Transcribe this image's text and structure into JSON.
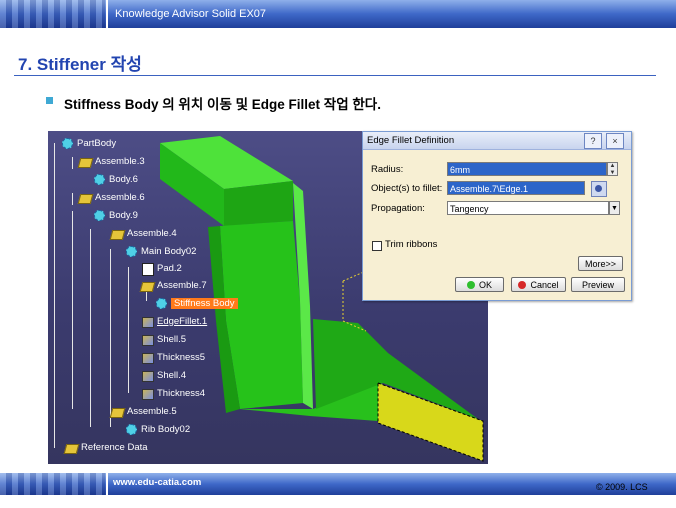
{
  "header": {
    "title": "Knowledge Advisor Solid EX07"
  },
  "slide": {
    "title": "7. Stiffener 작성",
    "bullet": "Stiffness Body 의 위치 이동 및 Edge Fillet 작업 한다."
  },
  "tree": {
    "items": [
      {
        "label": "PartBody"
      },
      {
        "label": "Assemble.3"
      },
      {
        "label": "Body.6"
      },
      {
        "label": "Assemble.6"
      },
      {
        "label": "Body.9"
      },
      {
        "label": "Assemble.4"
      },
      {
        "label": "Main Body02"
      },
      {
        "label": "Pad.2"
      },
      {
        "label": "Assemble.7"
      },
      {
        "label": "Stiffness Body"
      },
      {
        "label": "EdgeFillet.1"
      },
      {
        "label": "Shell.5"
      },
      {
        "label": "Thickness5"
      },
      {
        "label": "Shell.4"
      },
      {
        "label": "Thickness4"
      },
      {
        "label": "Assemble.5"
      },
      {
        "label": "Rib Body02"
      },
      {
        "label": "Reference Data"
      }
    ]
  },
  "dialog": {
    "title": "Edge Fillet Definition",
    "help_icon": "?",
    "close_icon": "×",
    "radius_label": "Radius:",
    "radius_value": "6mm",
    "objects_label": "Object(s) to fillet:",
    "objects_value": "Assemble.7\\Edge.1",
    "propagation_label": "Propagation:",
    "propagation_value": "Tangency",
    "trim_label": "Trim ribbons",
    "more_label": "More>>",
    "ok_label": "OK",
    "cancel_label": "Cancel",
    "preview_label": "Preview"
  },
  "colors": {
    "accent": "#2244b0",
    "highlight": "#ff7a1a",
    "part_green": "#2ecc1f",
    "part_yellow": "#d8d81a"
  },
  "footer": {
    "url": "www.edu-catia.com",
    "copyright": "© 2009. LCS"
  }
}
